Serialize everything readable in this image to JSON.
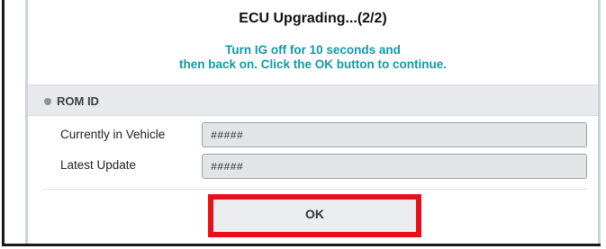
{
  "dialog": {
    "title": "ECU Upgrading...(2/2)",
    "message_line1": "Turn IG off for 10 seconds and",
    "message_line2": "then back on. Click the OK button to continue."
  },
  "rom_section": {
    "header": "ROM ID",
    "rows": [
      {
        "label": "Currently in Vehicle",
        "value": "#####"
      },
      {
        "label": "Latest Update",
        "value": "#####"
      }
    ]
  },
  "ok_button": {
    "label": "OK"
  },
  "colors": {
    "message": "#1597a7",
    "highlight": "#e8101b",
    "header_bg": "#e7e9ec"
  }
}
